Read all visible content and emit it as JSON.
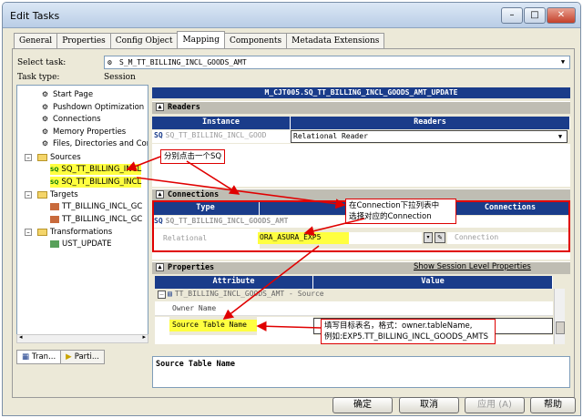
{
  "window": {
    "title": "Edit Tasks",
    "minimize": "–",
    "maximize": "□",
    "close": "✕"
  },
  "tabs": [
    "General",
    "Properties",
    "Config Object",
    "Mapping",
    "Components",
    "Metadata Extensions"
  ],
  "active_tab": "Mapping",
  "select_task": {
    "label": "Select task:",
    "value": "S_M_TT_BILLING_INCL_GOODS_AMT"
  },
  "task_type": {
    "label": "Task type:",
    "value": "Session"
  },
  "tree": {
    "items": [
      {
        "label": "Start Page"
      },
      {
        "label": "Pushdown Optimization"
      },
      {
        "label": "Connections"
      },
      {
        "label": "Memory Properties"
      },
      {
        "label": "Files, Directories and Com"
      }
    ],
    "sources_label": "Sources",
    "sources": [
      "SQ_TT_BILLING_INCL",
      "SQ_TT_BILLING_INCL"
    ],
    "targets_label": "Targets",
    "targets": [
      "TT_BILLING_INCL_GC",
      "TT_BILLING_INCL_GC"
    ],
    "transformations_label": "Transformations",
    "transformations": [
      "UST_UPDATE"
    ]
  },
  "bottom_tabs": [
    "Tran...",
    "Parti..."
  ],
  "mapping_title": "M_CJT005.SQ_TT_BILLING_INCL_GOODS_AMT_UPDATE",
  "readers": {
    "title": "Readers",
    "headers": [
      "Instance",
      "Readers"
    ],
    "row": {
      "instance": "SQ_TT_BILLING_INCL_GOOD",
      "reader": "Relational Reader"
    }
  },
  "connections": {
    "title": "Connections",
    "headers": [
      "Type",
      "V",
      "Connections"
    ],
    "group": "SQ_TT_BILLING_INCL_GOODS_AMT",
    "row": {
      "type": "Relational",
      "value": "ORA_ASURA_EXP5",
      "hint": "Connection"
    }
  },
  "properties": {
    "title": "Properties",
    "link": "Show Session Level Properties",
    "headers": [
      "Attribute",
      "Value"
    ],
    "group": "TT_BILLING_INCL_GOODS_AMT - Source",
    "rows": [
      {
        "attribute": "Owner Name",
        "value": ""
      },
      {
        "attribute": "Source Table Name",
        "value": ""
      }
    ]
  },
  "description": "Source Table Name",
  "callouts": {
    "sq": "分别点击一个SQ",
    "connection_line1": "在Connection下拉列表中",
    "connection_line2": "选择对应的Connection",
    "table_line1": "填写目标表名，格式：owner.tableName,",
    "table_line2": "例如:EXP5.TT_BILLING_INCL_GOODS_AMTS"
  },
  "buttons": {
    "ok": "确定",
    "cancel": "取消",
    "apply": "应用 (A)",
    "help": "帮助"
  }
}
